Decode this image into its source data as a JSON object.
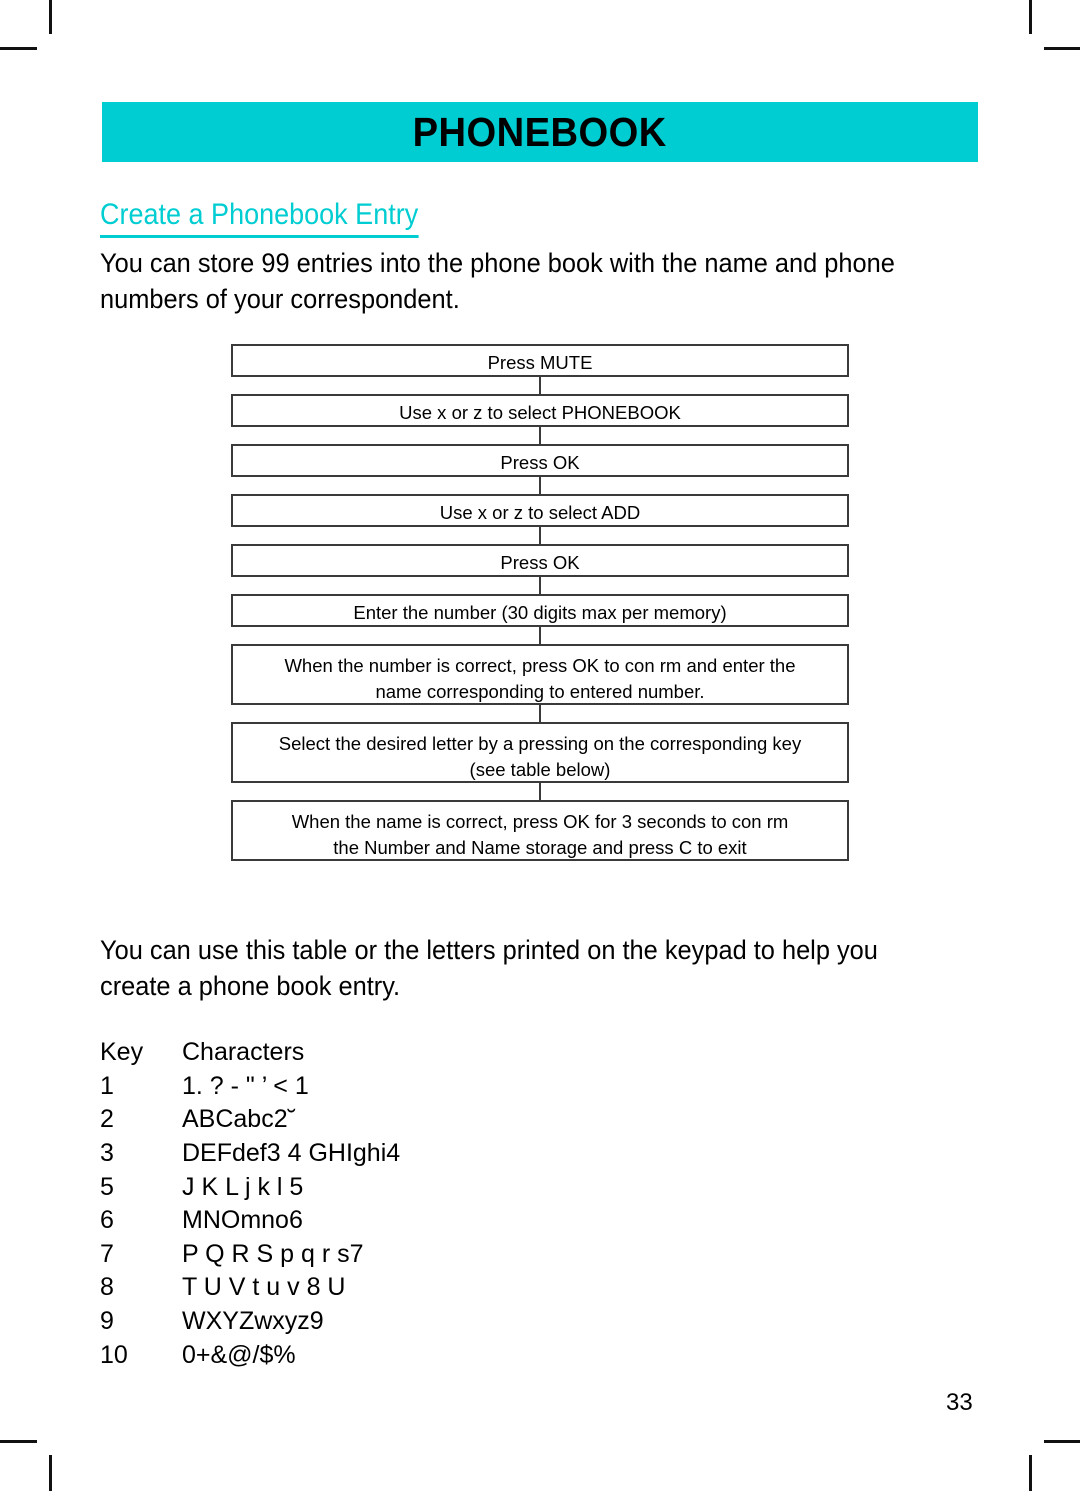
{
  "page": {
    "banner_title": "PHONEBOOK",
    "section_heading": "Create a Phonebook Entry",
    "page_number": "33",
    "accent_color": "#00cdd2",
    "background_color": "#ffffff",
    "text_color": "#000000"
  },
  "intro_paragraph": {
    "line1": "You can store 99 entries into the phone book with the name and phone",
    "line2": "numbers of your correspondent."
  },
  "flowchart": {
    "steps": [
      {
        "line1": "Press MUTE",
        "line2": ""
      },
      {
        "line1": "Use  x  or  z  to select  PHONEBOOK",
        "line2": ""
      },
      {
        "line1": "Press OK",
        "line2": ""
      },
      {
        "line1": "Use  x  or  z  to select  ADD",
        "line2": ""
      },
      {
        "line1": "Press OK",
        "line2": ""
      },
      {
        "line1": "Enter the number (30 digits max per memory)",
        "line2": ""
      },
      {
        "line1": "When the number is correct, press OK to con  rm and enter the",
        "line2": "name corresponding to entered number."
      },
      {
        "line1": "Select the desired letter by a pressing on the corresponding key",
        "line2": "(see table below)"
      },
      {
        "line1": "When the name is correct, press OK for 3 seconds to con  rm",
        "line2": "the Number and Name storage and press C to exit"
      }
    ]
  },
  "table_intro_paragraph": {
    "line1": "You can use this table or the letters printed on the keypad to help you",
    "line2": "create a phone book entry."
  },
  "key_table": {
    "headers": {
      "key": "Key",
      "characters": "Characters"
    },
    "rows": [
      {
        "key": "1",
        "characters": "1. ? - \" ’ < 1"
      },
      {
        "key": "2",
        "characters": "ABCabc2˘"
      },
      {
        "key": "3",
        "characters": "DEFdef3 4 GHIghi4"
      },
      {
        "key": "5",
        "characters": "J K L j k l 5"
      },
      {
        "key": "6",
        "characters": "MNOmno6"
      },
      {
        "key": "7",
        "characters": "P Q R S p q r s7"
      },
      {
        "key": "8",
        "characters": "T U V t u v 8 U"
      },
      {
        "key": "9",
        "characters": "WXYZwxyz9"
      },
      {
        "key": "10",
        "characters": "0+&@/$%"
      }
    ]
  }
}
